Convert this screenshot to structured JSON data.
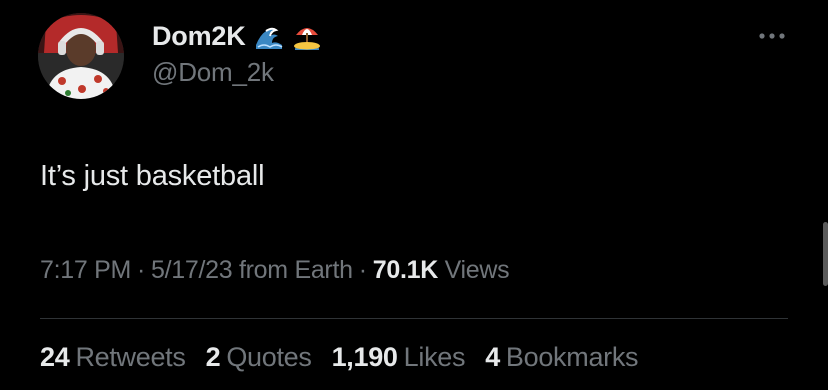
{
  "author": {
    "display_name": "Dom2K",
    "handle": "@Dom_2k",
    "name_emojis": [
      "water-wave-icon",
      "beach-umbrella-icon"
    ]
  },
  "tweet": {
    "text": "It’s just basketball"
  },
  "meta": {
    "time": "7:17 PM",
    "separator": "·",
    "date_source": "5/17/23 from Earth",
    "views_count": "70.1K",
    "views_label": "Views"
  },
  "stats": {
    "retweets_count": "24",
    "retweets_label": "Retweets",
    "quotes_count": "2",
    "quotes_label": "Quotes",
    "likes_count": "1,190",
    "likes_label": "Likes",
    "bookmarks_count": "4",
    "bookmarks_label": "Bookmarks"
  },
  "colors": {
    "background": "#000000",
    "primary_text": "#e7e9ea",
    "secondary_text": "#71767b",
    "divider": "#2f3336"
  },
  "icons": {
    "more": "more-options-icon"
  }
}
